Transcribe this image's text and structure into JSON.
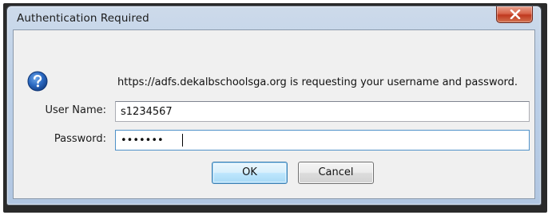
{
  "dialog": {
    "title": "Authentication Required",
    "close_icon": "close-icon",
    "message": "https://adfs.dekalbschoolsga.org is requesting your username and password.",
    "icon": "question-icon"
  },
  "form": {
    "username_label": "User Name:",
    "username_value": "s1234567",
    "password_label": "Password:",
    "password_value": "•••••••"
  },
  "buttons": {
    "ok_label": "OK",
    "cancel_label": "Cancel"
  },
  "colors": {
    "close_button": "#c0391f",
    "question_icon": "#1f5fb6",
    "focused_input_border": "#4f91c8"
  }
}
